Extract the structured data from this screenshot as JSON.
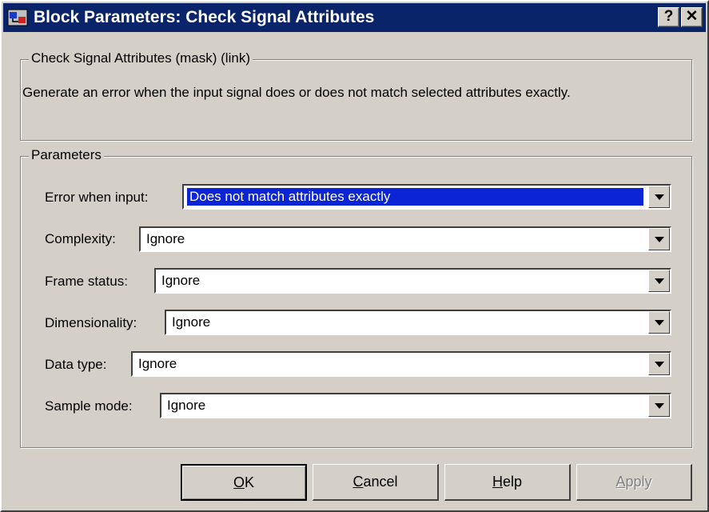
{
  "window": {
    "title": "Block Parameters: Check Signal Attributes"
  },
  "titlebar": {
    "help_label": "?",
    "close_label": "✕"
  },
  "description_group": {
    "title": "Check Signal Attributes (mask) (link)",
    "text": "Generate an error when the input signal does or does not match selected attributes exactly."
  },
  "parameters": {
    "title": "Parameters",
    "fields": [
      {
        "label": "Error when input:",
        "value": "Does not match attributes exactly"
      },
      {
        "label": "Complexity:",
        "value": "Ignore"
      },
      {
        "label": "Frame status:",
        "value": "Ignore"
      },
      {
        "label": "Dimensionality:",
        "value": "Ignore"
      },
      {
        "label": "Data type:",
        "value": "Ignore"
      },
      {
        "label": "Sample mode:",
        "value": "Ignore"
      }
    ]
  },
  "buttons": {
    "ok": {
      "mnemonic": "O",
      "rest": "K"
    },
    "cancel": {
      "mnemonic": "C",
      "rest": "ancel"
    },
    "help": {
      "mnemonic": "H",
      "rest": "elp"
    },
    "apply": {
      "mnemonic": "A",
      "rest": "pply"
    }
  },
  "colors": {
    "titlebar": "#0a246a",
    "face": "#d4d0c8",
    "selection": "#0a24d6"
  }
}
